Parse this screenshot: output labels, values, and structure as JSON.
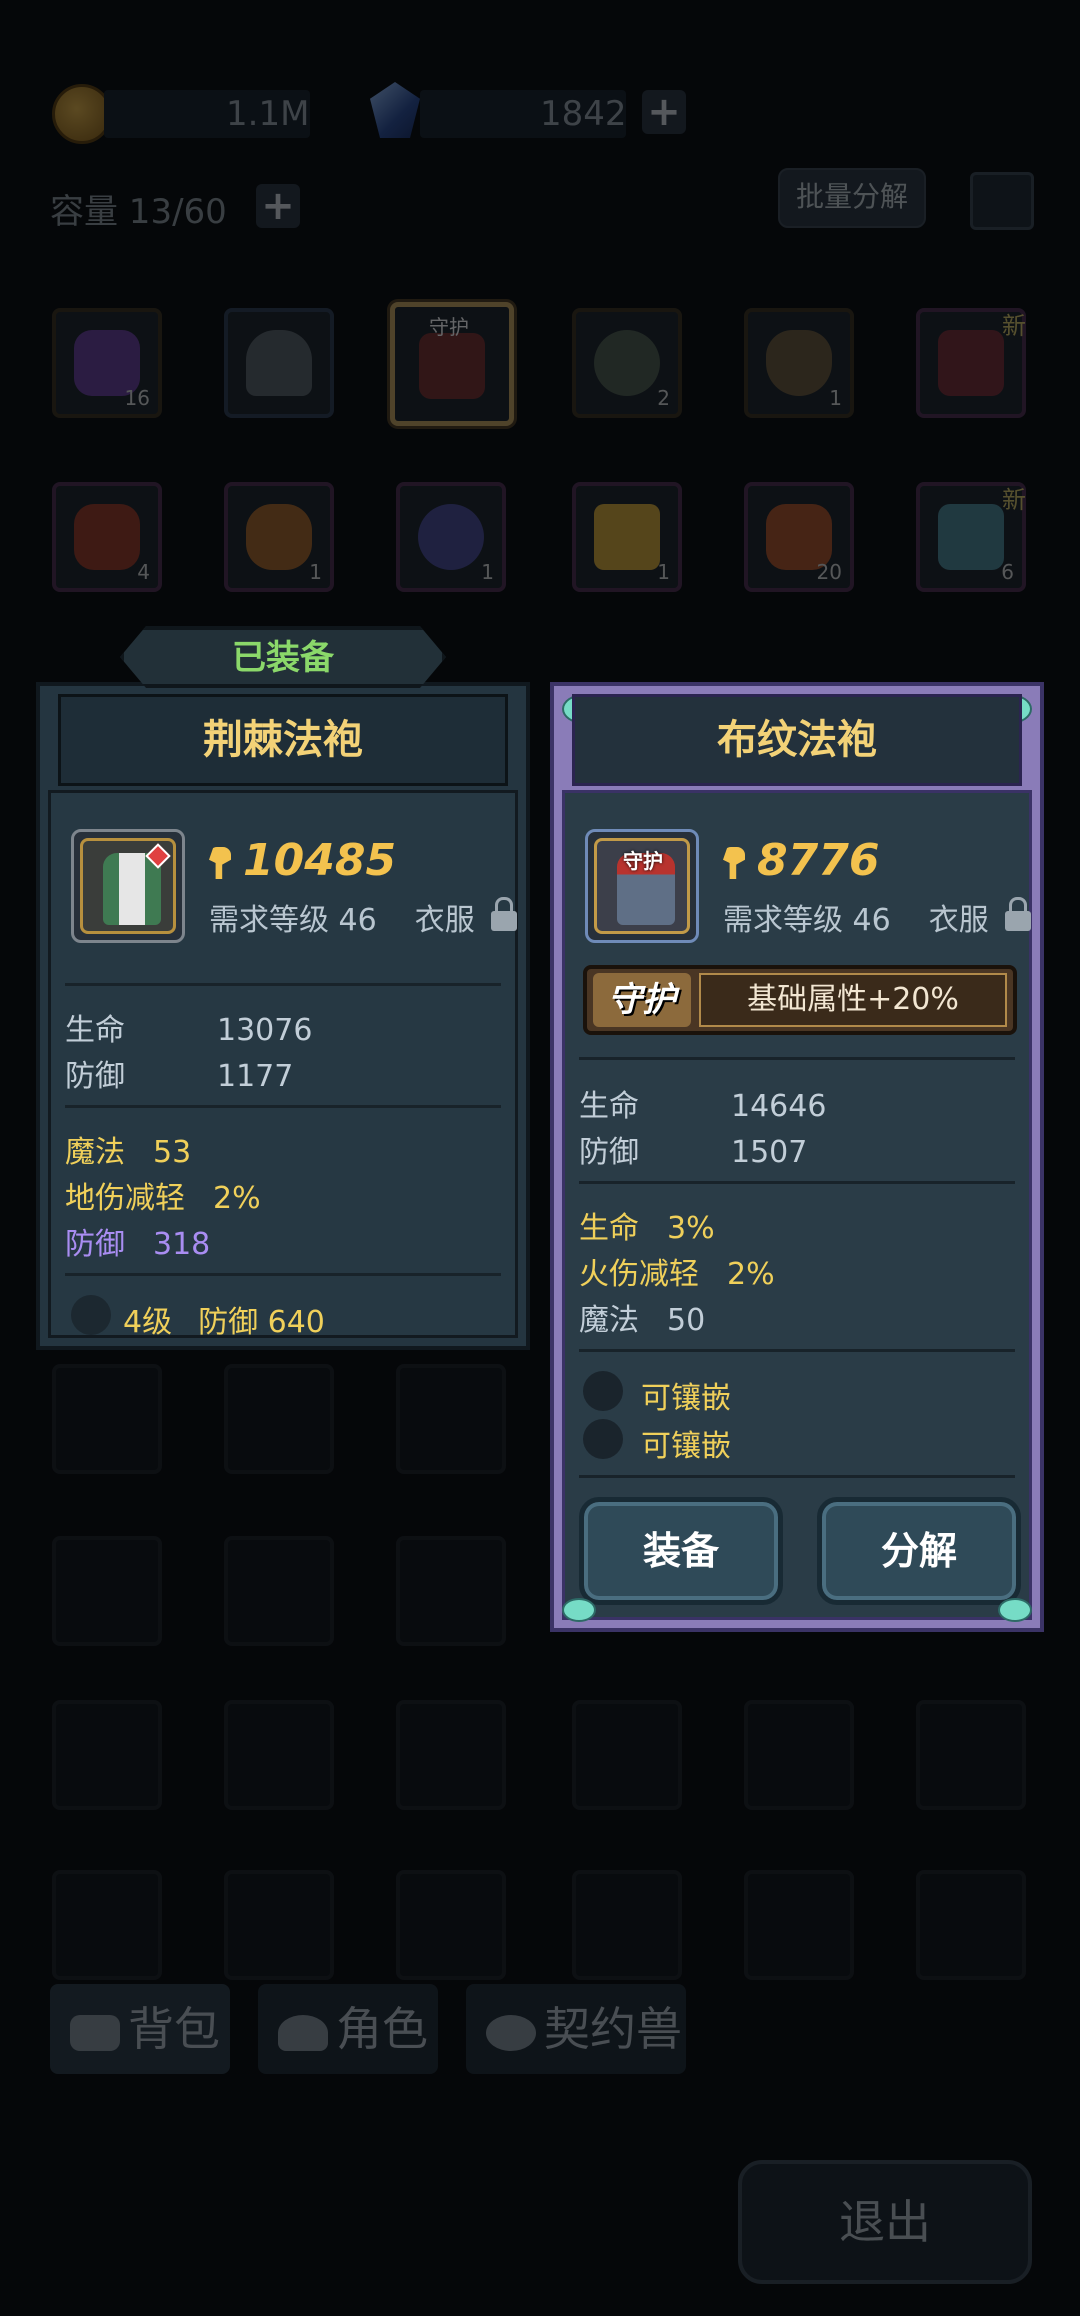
{
  "currency": {
    "gold": "1.1M",
    "crystal": "1842"
  },
  "inventory": {
    "capacity": "容量 13/60",
    "batch_label": "批量分解",
    "row1": [
      {
        "count": "16",
        "badge": "",
        "tag": ""
      },
      {
        "count": "",
        "badge": "",
        "tag": ""
      },
      {
        "count": "",
        "badge": "",
        "tag": "守护"
      },
      {
        "count": "2",
        "badge": "",
        "tag": ""
      },
      {
        "count": "1",
        "badge": "",
        "tag": ""
      },
      {
        "count": "",
        "badge": "新",
        "tag": ""
      }
    ],
    "row2": [
      {
        "count": "4",
        "badge": ""
      },
      {
        "count": "1",
        "badge": ""
      },
      {
        "count": "1",
        "badge": ""
      },
      {
        "count": "1",
        "badge": ""
      },
      {
        "count": "20",
        "badge": ""
      },
      {
        "count": "6",
        "badge": "新"
      }
    ]
  },
  "equipped": {
    "tab_label": "已装备",
    "name": "荆棘法袍",
    "power": "10485",
    "req_level": "需求等级 46",
    "type": "衣服",
    "base": [
      {
        "k": "生命",
        "v": "13076"
      },
      {
        "k": "防御",
        "v": "1177"
      }
    ],
    "extra": [
      {
        "k": "魔法",
        "v": "53"
      },
      {
        "k": "地伤减轻",
        "v": "2%"
      },
      {
        "k": "防御",
        "v": "318"
      }
    ],
    "enhance": {
      "level": "4级",
      "stat": "防御 640"
    }
  },
  "candidate": {
    "name": "布纹法袍",
    "slot_tag": "守护",
    "power": "8776",
    "req_level": "需求等级 46",
    "type": "衣服",
    "affix_label": "守护",
    "affix_desc": "基础属性+20%",
    "base": [
      {
        "k": "生命",
        "v": "14646"
      },
      {
        "k": "防御",
        "v": "1507"
      }
    ],
    "extra": [
      {
        "k": "生命",
        "v": "3%"
      },
      {
        "k": "火伤减轻",
        "v": "2%"
      },
      {
        "k": "魔法",
        "v": "50"
      }
    ],
    "sockets": [
      "可镶嵌",
      "可镶嵌"
    ],
    "equip_label": "装备",
    "decompose_label": "分解"
  },
  "tabs": [
    "背包",
    "角色",
    "契约兽"
  ],
  "exit_label": "退出",
  "colors": {
    "accent_gold": "#f3d277",
    "stat_yellow": "#f0d05a",
    "stat_purple": "#a98df2",
    "equipped_green": "#8bd86a"
  }
}
